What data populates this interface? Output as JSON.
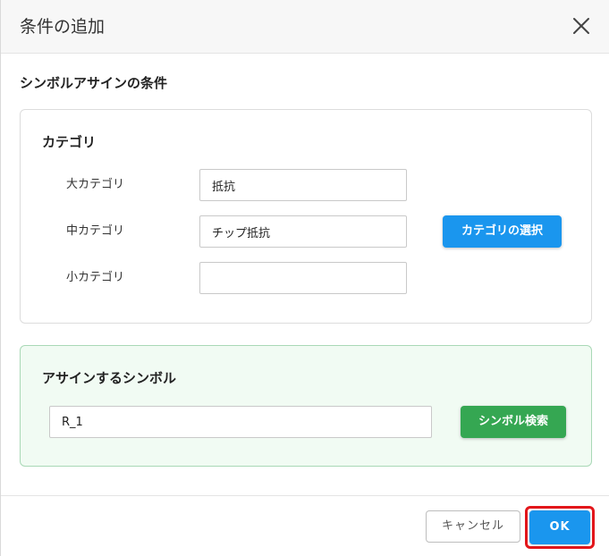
{
  "dialog": {
    "title": "条件の追加",
    "close_label": "×"
  },
  "section": {
    "title": "シンボルアサインの条件"
  },
  "category": {
    "title": "カテゴリ",
    "fields": [
      {
        "label": "大カテゴリ",
        "value": "抵抗"
      },
      {
        "label": "中カテゴリ",
        "value": "チップ抵抗"
      },
      {
        "label": "小カテゴリ",
        "value": ""
      }
    ],
    "select_button": "カテゴリの選択"
  },
  "symbol": {
    "title": "アサインするシンボル",
    "value": "R_1",
    "search_button": "シンボル検索"
  },
  "footer": {
    "cancel_label": "キャンセル",
    "ok_label": "OK"
  },
  "colors": {
    "primary": "#1a96ee",
    "success": "#35a752",
    "highlight": "#e3161b",
    "symbol_card_bg": "#f1fbf3"
  },
  "icons": {
    "close": "close-icon"
  }
}
